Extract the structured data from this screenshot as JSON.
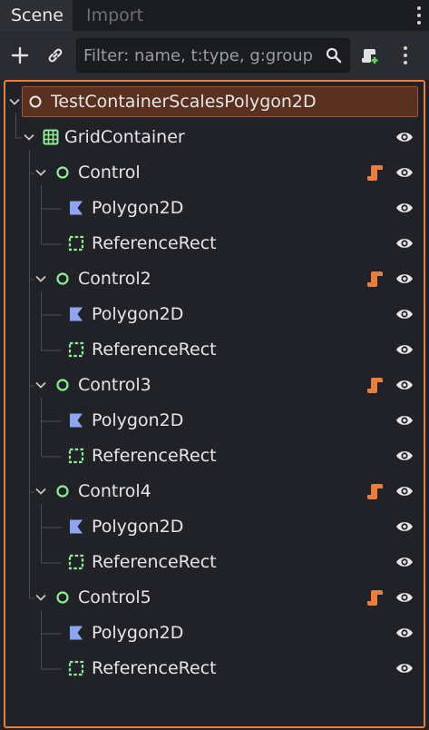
{
  "tabs": [
    {
      "label": "Scene",
      "active": true
    },
    {
      "label": "Import",
      "active": false
    }
  ],
  "toolbar": {
    "add_icon": "plus-icon",
    "link_icon": "link-icon",
    "filter_placeholder": "Filter: name, t:type, g:group",
    "filter_value": "",
    "search_icon": "search-icon",
    "attach_script_icon": "attach-script-icon",
    "menu_icon": "more-vertical-icon"
  },
  "colors": {
    "selection_border": "#e97e3e",
    "root_selection_bg": "#5a3020",
    "control_node": "#8eef97",
    "node2d": "#8da5f3",
    "script": "#e97e3e"
  },
  "tree": {
    "root": {
      "label": "TestContainerScalesPolygon2D",
      "icon": "node-icon",
      "selected": true
    },
    "grid": {
      "label": "GridContainer",
      "icon": "grid-container-icon",
      "visible": true
    },
    "controls": [
      {
        "label": "Control",
        "children": [
          {
            "label": "Polygon2D",
            "icon": "polygon2d-icon"
          },
          {
            "label": "ReferenceRect",
            "icon": "reference-rect-icon"
          }
        ]
      },
      {
        "label": "Control2",
        "children": [
          {
            "label": "Polygon2D",
            "icon": "polygon2d-icon"
          },
          {
            "label": "ReferenceRect",
            "icon": "reference-rect-icon"
          }
        ]
      },
      {
        "label": "Control3",
        "children": [
          {
            "label": "Polygon2D",
            "icon": "polygon2d-icon"
          },
          {
            "label": "ReferenceRect",
            "icon": "reference-rect-icon"
          }
        ]
      },
      {
        "label": "Control4",
        "children": [
          {
            "label": "Polygon2D",
            "icon": "polygon2d-icon"
          },
          {
            "label": "ReferenceRect",
            "icon": "reference-rect-icon"
          }
        ]
      },
      {
        "label": "Control5",
        "children": [
          {
            "label": "Polygon2D",
            "icon": "polygon2d-icon"
          },
          {
            "label": "ReferenceRect",
            "icon": "reference-rect-icon"
          }
        ]
      }
    ]
  }
}
